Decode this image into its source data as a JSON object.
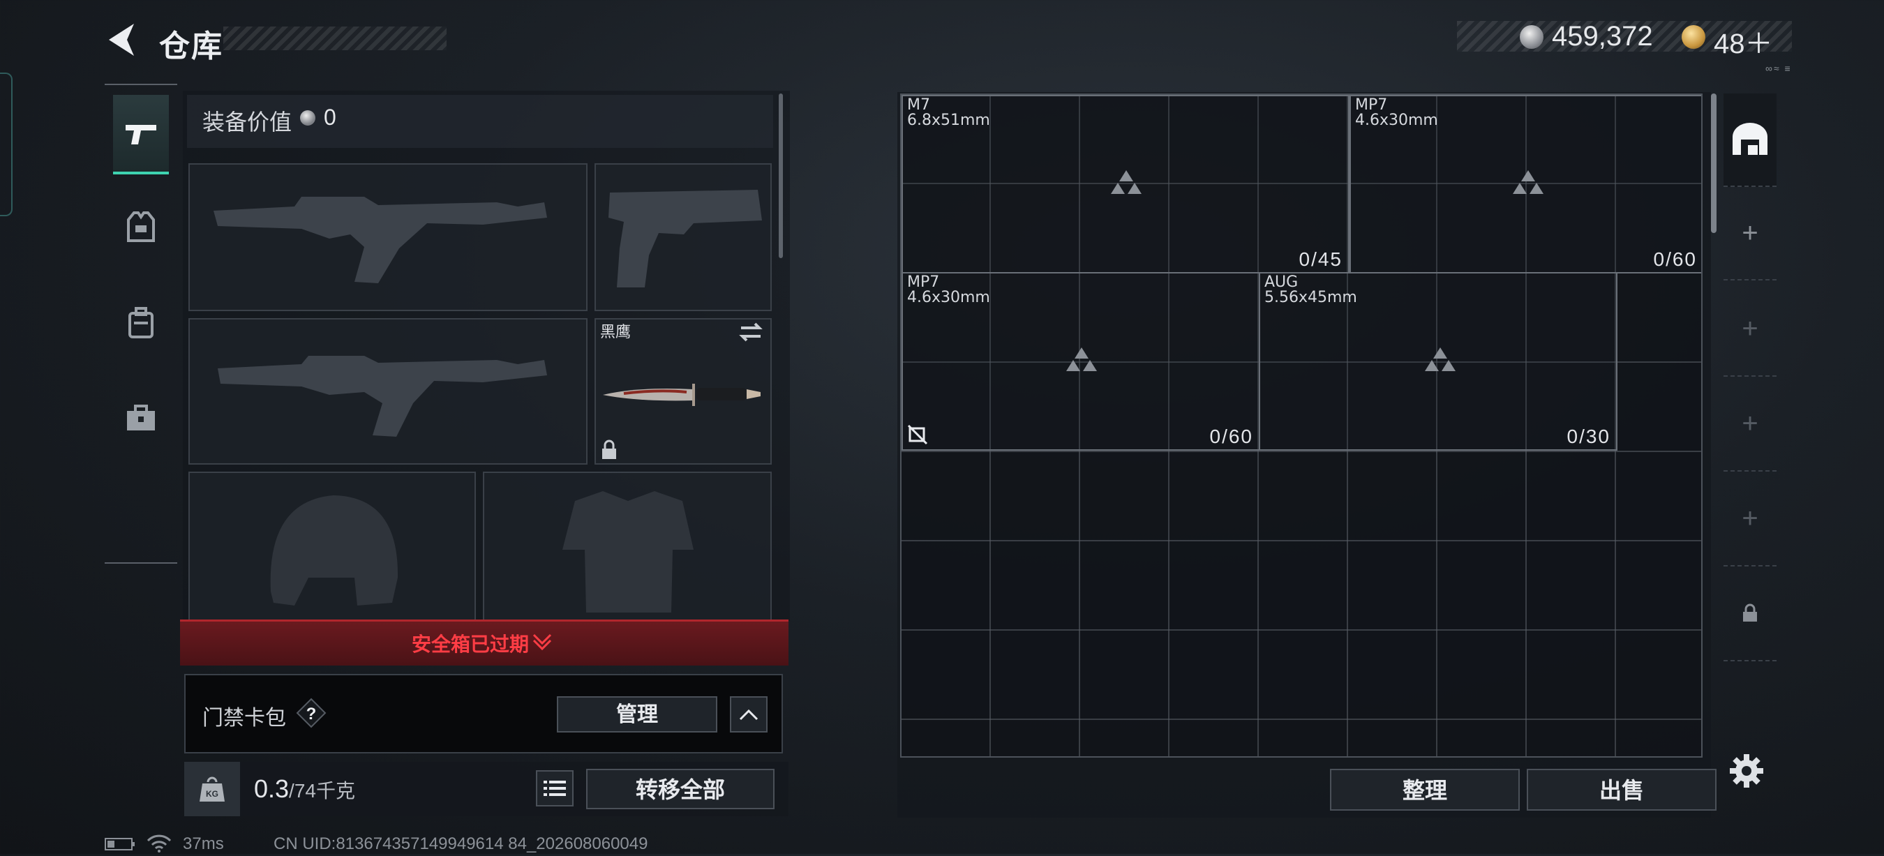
{
  "header": {
    "title": "仓库",
    "money": "459,372",
    "tokens": "48＋",
    "tiny_marks": "∞≈ ≡"
  },
  "equipment": {
    "value_label": "装备价值",
    "value": "0",
    "melee_name": "黑鹰",
    "safebox_status": "安全箱已过期"
  },
  "keycard": {
    "label": "门禁卡包",
    "help": "?",
    "manage_label": "管理"
  },
  "weight": {
    "current": "0.3",
    "max": "/74千克",
    "icon_label": "KG"
  },
  "actions": {
    "transfer_all": "转移全部",
    "sort": "整理",
    "sell": "出售"
  },
  "stash": {
    "items": [
      {
        "name": "M7",
        "caliber": "6.8x51mm",
        "count": "0/45"
      },
      {
        "name": "MP7",
        "caliber": "4.6x30mm",
        "count": "0/60"
      },
      {
        "name": "MP7",
        "caliber": "4.6x30mm",
        "count": "0/60"
      },
      {
        "name": "AUG",
        "caliber": "5.56x45mm",
        "count": "0/30"
      }
    ]
  },
  "page_rail": {
    "add_symbol": "+"
  },
  "status": {
    "ping": "37ms",
    "uid": "CN UID:813674357149949614 84_202608060049"
  }
}
